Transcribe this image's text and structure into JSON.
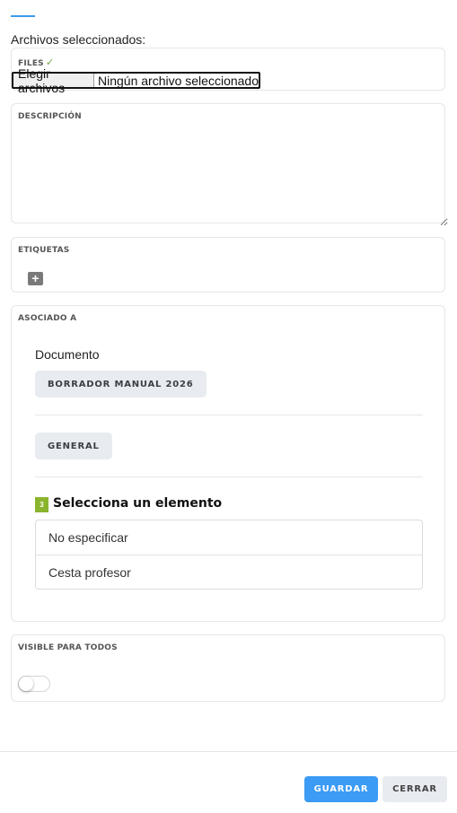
{
  "files_heading": "Archivos seleccionados:",
  "files_card": {
    "label": "FILES",
    "check": "✓",
    "choose_button": "Elegir archivos",
    "no_file_text": "Ningún archivo seleccionado"
  },
  "description_card": {
    "label": "DESCRIPCIÓN"
  },
  "tags_card": {
    "label": "ETIQUETAS",
    "add_icon": "+"
  },
  "associated_card": {
    "label": "ASOCIADO A",
    "document_label": "Documento",
    "document_chip": "BORRADOR MANUAL 2026",
    "general_chip": "GENERAL",
    "step_number": "3",
    "select_title": "Selecciona un elemento",
    "options": [
      "No especificar",
      "Cesta profesor"
    ]
  },
  "visible_card": {
    "label": "VISIBLE PARA TODOS",
    "toggle_on": false
  },
  "footer": {
    "save_label": "GUARDAR",
    "close_label": "CERRAR"
  },
  "colors": {
    "accent": "#3b9bf5",
    "step_badge": "#8ab42d",
    "check": "#6aa63a"
  }
}
